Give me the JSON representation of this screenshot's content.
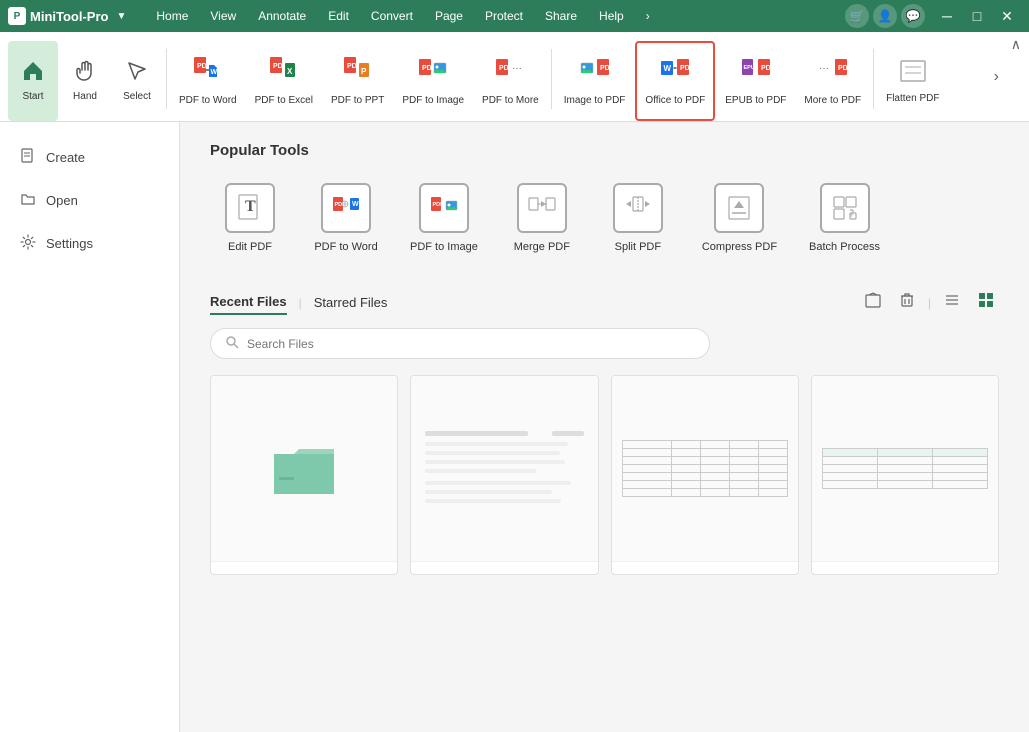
{
  "app": {
    "name": "MiniTool-Pro",
    "logo_letter": "P"
  },
  "title_bar": {
    "menu_items": [
      "Home",
      "View",
      "Annotate",
      "Edit",
      "Convert",
      "Page",
      "Protect",
      "Share",
      "Help"
    ],
    "more_label": "›"
  },
  "ribbon": {
    "items": [
      {
        "id": "start",
        "label": "Start",
        "icon": "🏠"
      },
      {
        "id": "hand",
        "label": "Hand",
        "icon": "✋"
      },
      {
        "id": "select",
        "label": "Select",
        "icon": "↖"
      },
      {
        "id": "pdf-to-word",
        "label": "PDF to Word",
        "icon": "W"
      },
      {
        "id": "pdf-to-excel",
        "label": "PDF to Excel",
        "icon": "X"
      },
      {
        "id": "pdf-to-ppt",
        "label": "PDF to PPT",
        "icon": "P"
      },
      {
        "id": "pdf-to-image",
        "label": "PDF to Image",
        "icon": "🖼"
      },
      {
        "id": "pdf-to-more",
        "label": "PDF to More",
        "icon": "⋯"
      },
      {
        "id": "image-to-pdf",
        "label": "Image to PDF",
        "icon": "📷"
      },
      {
        "id": "office-to-pdf",
        "label": "Office to PDF",
        "icon": "📄"
      },
      {
        "id": "epub-to-pdf",
        "label": "EPUB to PDF",
        "icon": "📖"
      },
      {
        "id": "more-to-pdf",
        "label": "More to PDF",
        "icon": "⋯"
      },
      {
        "id": "flatten-pdf",
        "label": "Flatten PDF",
        "icon": "⬜"
      }
    ],
    "collapse_btn": "∧"
  },
  "sidebar": {
    "items": [
      {
        "id": "create",
        "label": "Create",
        "icon": "📄"
      },
      {
        "id": "open",
        "label": "Open",
        "icon": "📂"
      },
      {
        "id": "settings",
        "label": "Settings",
        "icon": "⚙"
      }
    ]
  },
  "popular_tools": {
    "title": "Popular Tools",
    "items": [
      {
        "id": "edit-pdf",
        "label": "Edit PDF",
        "icon": "T"
      },
      {
        "id": "pdf-to-word",
        "label": "PDF to Word",
        "icon": "W"
      },
      {
        "id": "pdf-to-image",
        "label": "PDF to Image",
        "icon": "🖼"
      },
      {
        "id": "merge-pdf",
        "label": "Merge PDF",
        "icon": "⇄"
      },
      {
        "id": "split-pdf",
        "label": "Split PDF",
        "icon": "✂"
      },
      {
        "id": "compress-pdf",
        "label": "Compress PDF",
        "icon": "↧"
      },
      {
        "id": "batch-process",
        "label": "Batch Process",
        "icon": "⊞"
      }
    ]
  },
  "files_section": {
    "recent_label": "Recent Files",
    "starred_label": "Starred Files",
    "active_tab": "recent",
    "search_placeholder": "Search Files",
    "files": [
      {
        "id": "file1",
        "type": "empty",
        "name": ""
      },
      {
        "id": "file2",
        "type": "text",
        "name": ""
      },
      {
        "id": "file3",
        "type": "table",
        "name": ""
      },
      {
        "id": "file4",
        "type": "table2",
        "name": ""
      }
    ]
  },
  "colors": {
    "brand": "#2d7d5a",
    "highlight": "#e74c3c",
    "bg": "#f5f5f5",
    "white": "#ffffff"
  }
}
